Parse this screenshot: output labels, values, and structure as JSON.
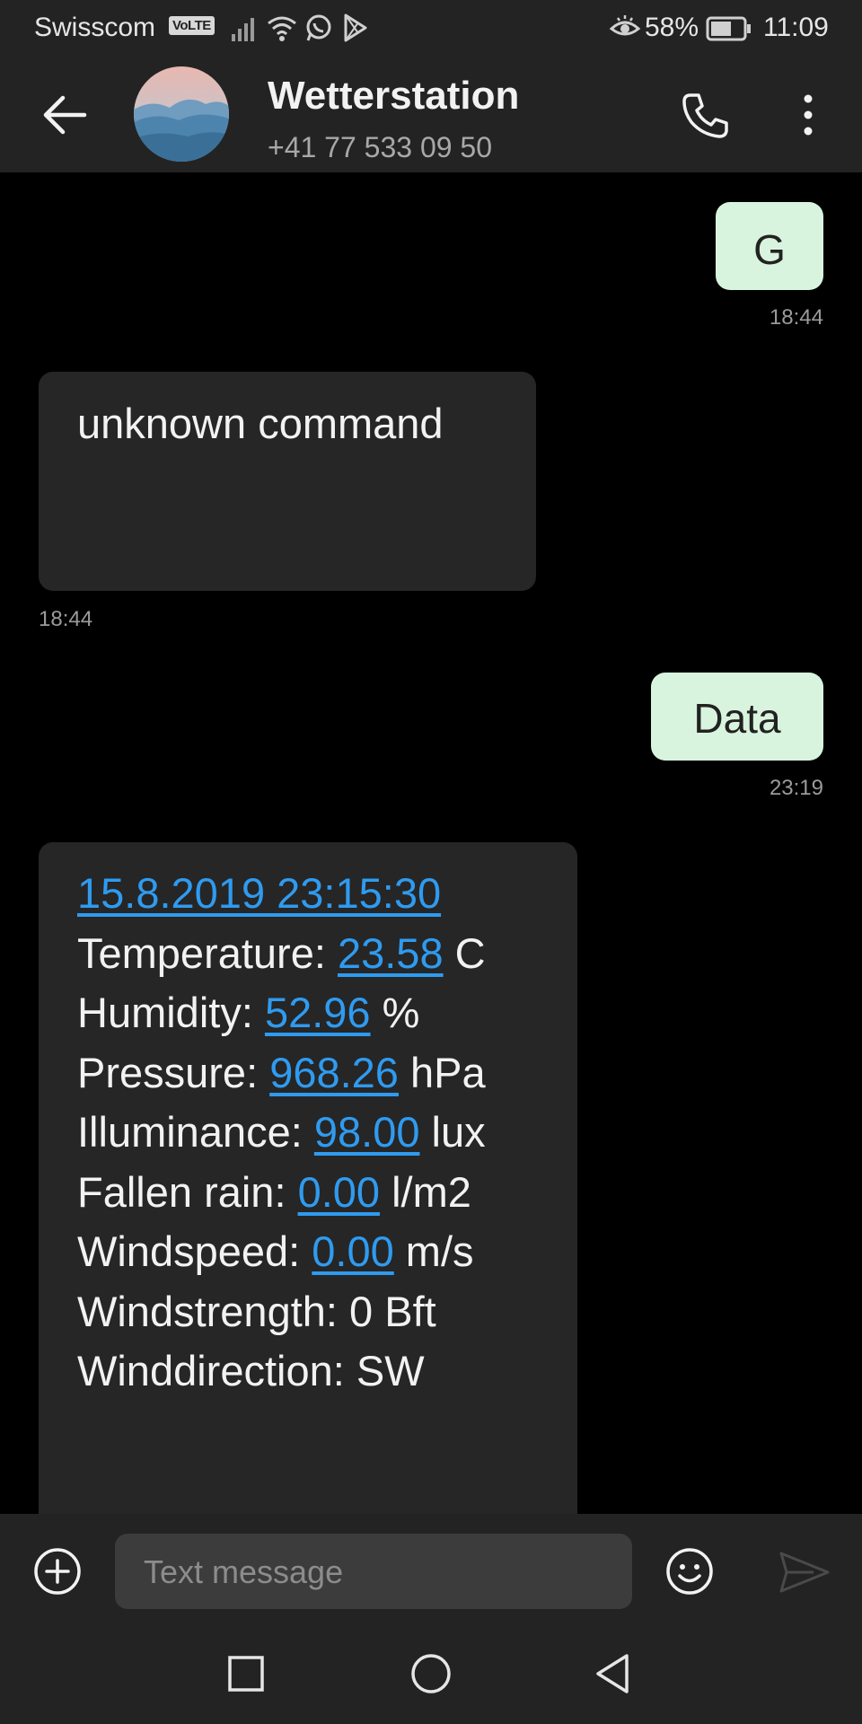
{
  "status_bar": {
    "carrier": "Swisscom",
    "volte": "VoLTE",
    "battery_percent": "58%",
    "time": "11:09"
  },
  "header": {
    "contact_name": "Wetterstation",
    "contact_number": "+41 77 533 09 50"
  },
  "messages": [
    {
      "direction": "outgoing",
      "text": "G",
      "time": "18:44"
    },
    {
      "direction": "incoming",
      "text": "unknown command",
      "time": "18:44"
    },
    {
      "direction": "outgoing",
      "text": "Data",
      "time": "23:19"
    }
  ],
  "data_message": {
    "datetime": "15.8.2019 23:15:30",
    "lines": [
      {
        "label": "Temperature: ",
        "value": "23.58",
        "unit": " C"
      },
      {
        "label": "Humidity: ",
        "value": "52.96",
        "unit": " %"
      },
      {
        "label": "Pressure: ",
        "value": "968.26",
        "unit": " hPa"
      },
      {
        "label": "Illuminance: ",
        "value": "98.00",
        "unit": " lux"
      },
      {
        "label": "Fallen rain: ",
        "value": "0.00",
        "unit": " l/m2"
      },
      {
        "label": "Windspeed: ",
        "value": "0.00",
        "unit": " m/s"
      }
    ],
    "windstrength": "Windstrength: 0 Bft",
    "winddirection": "Winddirection: SW"
  },
  "compose": {
    "placeholder": "Text message"
  },
  "colors": {
    "outgoing_bubble": "#d9f4de",
    "incoming_bubble": "#262626",
    "link": "#2f9bf0",
    "bar_background": "#232323"
  }
}
